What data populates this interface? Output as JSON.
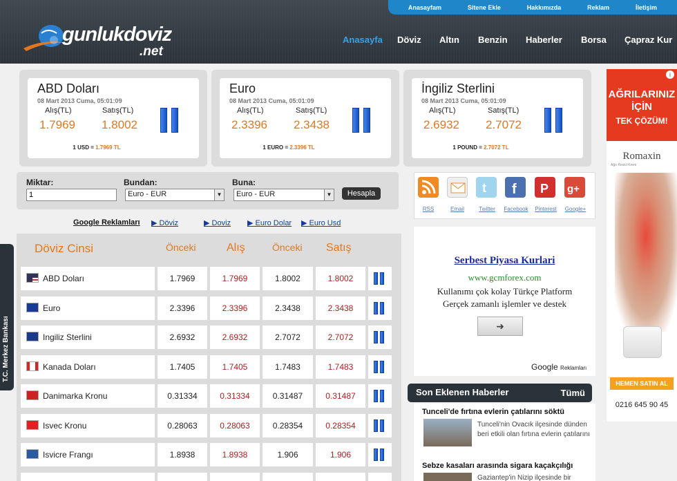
{
  "topnav": [
    "Anasayfam",
    "Sitene Ekle",
    "Hakkımızda",
    "Reklam",
    "İletişim"
  ],
  "logo": {
    "main": "gunlukdoviz",
    "ext": ".net"
  },
  "mainnav": [
    "Anasayfa",
    "Döviz",
    "Altın",
    "Benzin",
    "Haberler",
    "Borsa",
    "Çapraz Kur"
  ],
  "cards": [
    {
      "name": "ABD Doları",
      "date": "08 Mart 2013 Cuma, 05:01:09",
      "alis_label": "Alış(TL)",
      "satis_label": "Satış(TL)",
      "alis": "1.7969",
      "satis": "1.8002",
      "conv_prefix": "1 USD = ",
      "conv_value": "1.7969 TL"
    },
    {
      "name": "Euro",
      "date": "08 Mart 2013 Cuma, 05:01:09",
      "alis_label": "Alış(TL)",
      "satis_label": "Satış(TL)",
      "alis": "2.3396",
      "satis": "2.3438",
      "conv_prefix": "1 EURO = ",
      "conv_value": "2.3396 TL"
    },
    {
      "name": "İngiliz Sterlini",
      "date": "08 Mart 2013 Cuma, 05:01:09",
      "alis_label": "Alış(TL)",
      "satis_label": "Satış(TL)",
      "alis": "2.6932",
      "satis": "2.7072",
      "conv_prefix": "1 POUND = ",
      "conv_value": "2.7072 TL"
    }
  ],
  "converter": {
    "miktar_label": "Miktar:",
    "miktar_value": "1",
    "bundan_label": "Bundan:",
    "bundan_value": "Euro - EUR",
    "buna_label": "Buna:",
    "buna_value": "Euro - EUR",
    "button": "Hesapla"
  },
  "google_ads": {
    "label": "Google Reklamları",
    "links": [
      "▶ Döviz",
      "▶ Doviz",
      "▶ Euro Dolar",
      "▶ Euro Usd"
    ]
  },
  "table": {
    "headers": [
      "Döviz Cinsi",
      "Önceki",
      "Alış",
      "Önceki",
      "Satış"
    ],
    "rows": [
      {
        "name": "ABD Doları",
        "flag": "us-flag",
        "prev_buy": "1.7969",
        "buy": "1.7969",
        "prev_sell": "1.8002",
        "sell": "1.8002"
      },
      {
        "name": "Euro",
        "flag": "eu-flag",
        "prev_buy": "2.3396",
        "buy": "2.3396",
        "prev_sell": "2.3438",
        "sell": "2.3438"
      },
      {
        "name": "Ingiliz Sterlini",
        "flag": "uk-flag",
        "prev_buy": "2.6932",
        "buy": "2.6932",
        "prev_sell": "2.7072",
        "sell": "2.7072"
      },
      {
        "name": "Kanada Doları",
        "flag": "canada-flag",
        "prev_buy": "1.7405",
        "buy": "1.7405",
        "prev_sell": "1.7483",
        "sell": "1.7483"
      },
      {
        "name": "Danimarka Kronu",
        "flag": "denmark-flag",
        "prev_buy": "0.31334",
        "buy": "0.31334",
        "prev_sell": "0.31487",
        "sell": "0.31487"
      },
      {
        "name": "Isvec Kronu",
        "flag": "swiss-flag",
        "prev_buy": "0.28063",
        "buy": "0.28063",
        "prev_sell": "0.28354",
        "sell": "0.28354"
      },
      {
        "name": "Isvicre Frangı",
        "flag": "sweden-flag",
        "prev_buy": "1.8938",
        "buy": "1.8938",
        "prev_sell": "1.906",
        "sell": "1.906"
      }
    ]
  },
  "side_tab": "T.C. Merkez Bankası",
  "social": [
    {
      "icon": "rss-icon",
      "label": "RSS"
    },
    {
      "icon": "email-icon",
      "label": "Email"
    },
    {
      "icon": "twitter-icon",
      "label": "Twitter"
    },
    {
      "icon": "facebook-icon",
      "label": "Facebook"
    },
    {
      "icon": "pinterest-icon",
      "label": "Pinterest"
    },
    {
      "icon": "googleplus-icon",
      "label": "Google+"
    }
  ],
  "ad": {
    "title": "Serbest Piyasa Kurlari",
    "url": "www.gcmforex.com",
    "line1": "Kullanımı çok kolay Türkçe Platform",
    "line2": "Gerçek zamanlı işlemler ve destek",
    "footer": "Reklamları",
    "footer_brand": "Google"
  },
  "news": {
    "title": "Son Eklenen Haberler",
    "all": "Tümü",
    "items": [
      {
        "headline": "Tunceli'de fırtına evlerin çatılarını söktü",
        "text": "Tunceli'nin Ovacık ilçesinde dünden beri etkili olan fırtına evlerin çatılarını"
      },
      {
        "headline": "Sebze kasaları arasında sigara kaçakçılığı",
        "text": "Gaziantep'in Nizip ilçesinde bir"
      }
    ]
  },
  "banner": {
    "line1": "AĞRILARINIZ",
    "line2": "İÇİN",
    "line3": "TEK ÇÖZÜM!",
    "brand": "Romaxin",
    "tagline": "Ağrı Kesici Krem",
    "cta": "HEMEN SATIN AL",
    "phone": "0216 645 90 45"
  },
  "colors": {
    "accent": "#e07820",
    "link": "#1a3a9a",
    "dark": "#2a323a",
    "nav_blue": "#1f86c9"
  }
}
